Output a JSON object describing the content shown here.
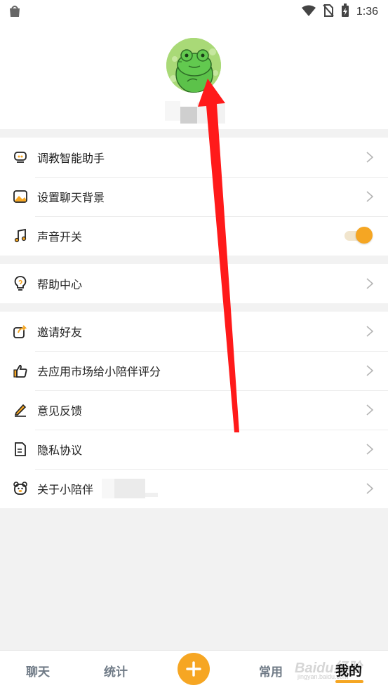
{
  "status_bar": {
    "time": "1:36",
    "icons": [
      "app-notification-icon",
      "wifi-icon",
      "no-sim-icon",
      "battery-charging-icon"
    ]
  },
  "profile": {
    "avatar_icon": "frog-avatar"
  },
  "settings_group_1": [
    {
      "label": "调教智能助手",
      "icon": "assistant-icon"
    },
    {
      "label": "设置聊天背景",
      "icon": "image-icon"
    },
    {
      "label": "声音开关",
      "icon": "music-note-icon",
      "toggle_on": true
    }
  ],
  "settings_group_2": [
    {
      "label": "帮助中心",
      "icon": "lightbulb-icon"
    }
  ],
  "settings_group_3": [
    {
      "label": "邀请好友",
      "icon": "share-icon"
    },
    {
      "label": "去应用市场给小陪伴评分",
      "icon": "thumbs-up-icon"
    },
    {
      "label": "意见反馈",
      "icon": "pencil-icon"
    },
    {
      "label": "隐私协议",
      "icon": "document-icon"
    },
    {
      "label": "关于小陪伴",
      "icon": "bear-icon"
    }
  ],
  "tabbar": {
    "tabs": [
      "聊天",
      "统计",
      "常用",
      "我的"
    ],
    "active": "我的",
    "add_icon": "plus-icon"
  },
  "watermark": {
    "text": "Baidu经验",
    "sub": "jingyan.baidu.com"
  },
  "colors": {
    "accent": "#f5a623",
    "annotation": "#ff1a1a"
  }
}
